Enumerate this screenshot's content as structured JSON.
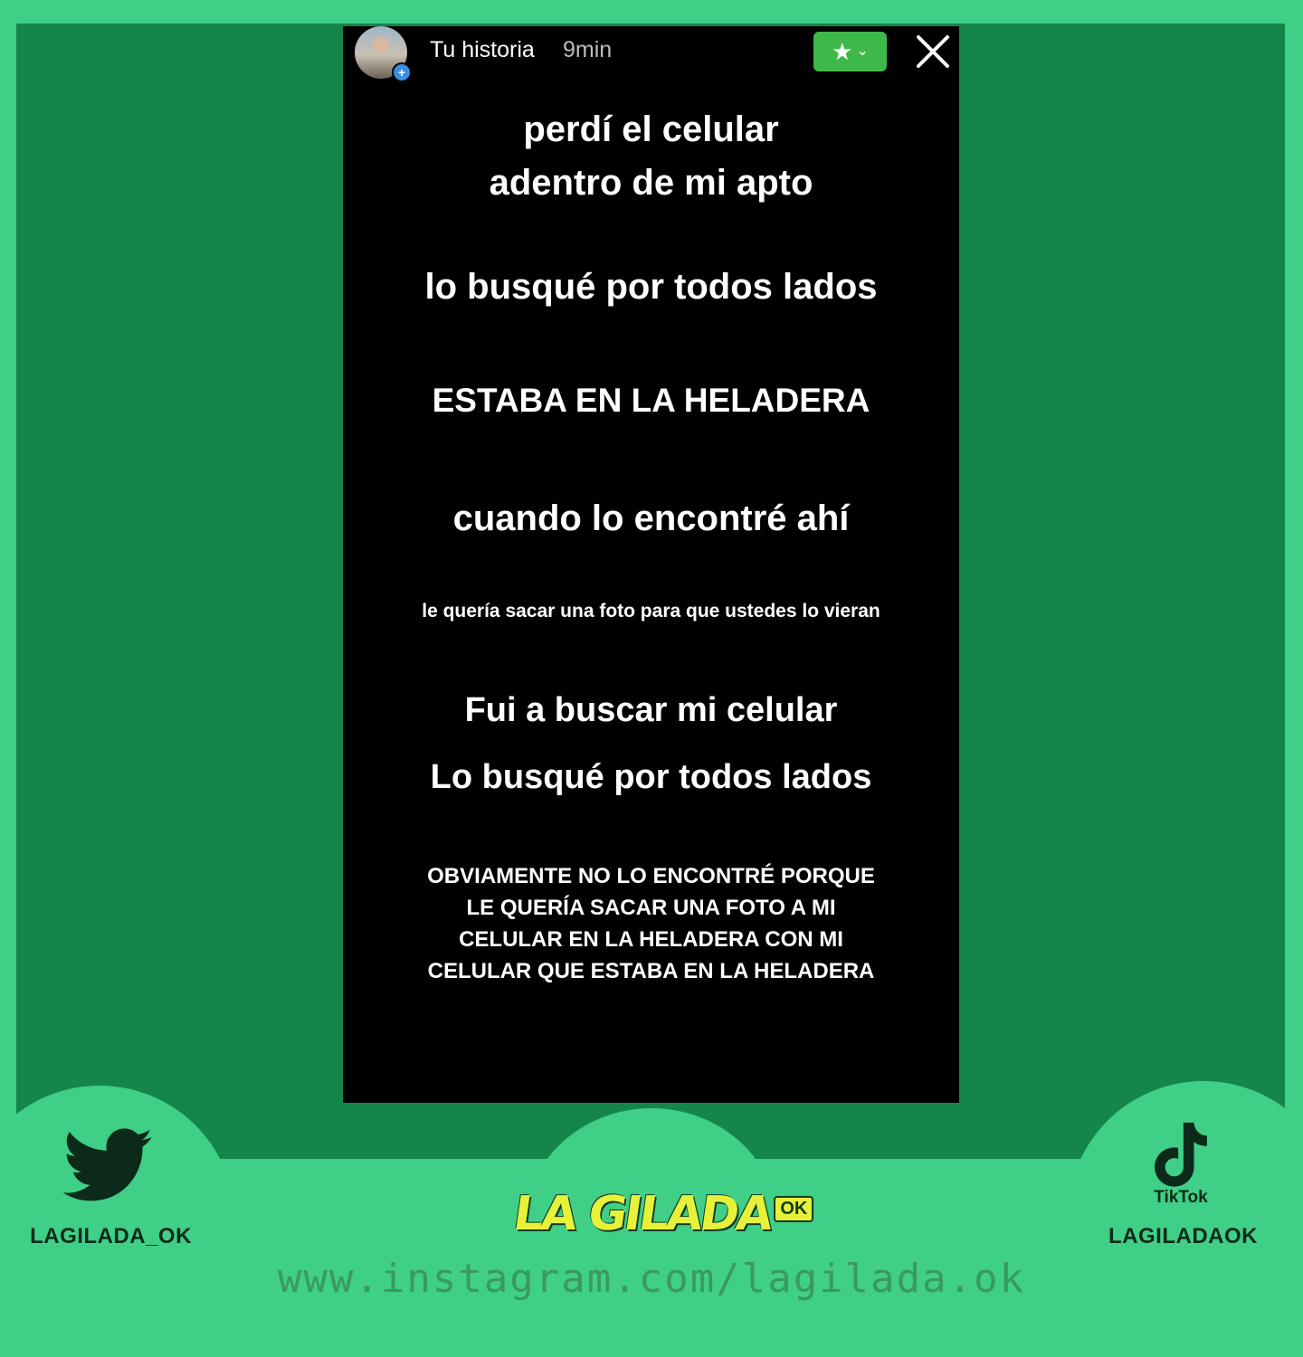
{
  "story": {
    "user": "Tu historia",
    "time": "9min",
    "lines": [
      "perdí el celular",
      "adentro de mi apto",
      "lo busqué por todos lados",
      "ESTABA EN LA HELADERA",
      "cuando lo encontré ahí",
      "le quería sacar una foto para que ustedes lo vieran",
      "Fui a buscar mi celular",
      "Lo busqué por todos lados"
    ],
    "paragraph": [
      "OBVIAMENTE NO LO ENCONTRÉ PORQUE",
      "LE QUERÍA SACAR UNA FOTO A MI",
      "CELULAR EN LA HELADERA CON MI",
      "CELULAR QUE ESTABA EN LA HELADERA"
    ]
  },
  "footer": {
    "twitter_handle": "LAGILADA_OK",
    "tiktok_word": "TikTok",
    "tiktok_handle": "LAGILADAOK",
    "brand": "LA GILADA",
    "brand_badge": "OK",
    "url": "www.instagram.com/lagilada.ok"
  },
  "colors": {
    "frame": "#3fcf86",
    "inner": "#15864a",
    "close_friends": "#3fb84a",
    "brand_yellow": "#e6f23a"
  },
  "icons": [
    "avatar",
    "add-story-icon",
    "close-friends-star-icon",
    "chevron-down-icon",
    "close-icon",
    "twitter-bird-icon",
    "tiktok-note-icon"
  ]
}
